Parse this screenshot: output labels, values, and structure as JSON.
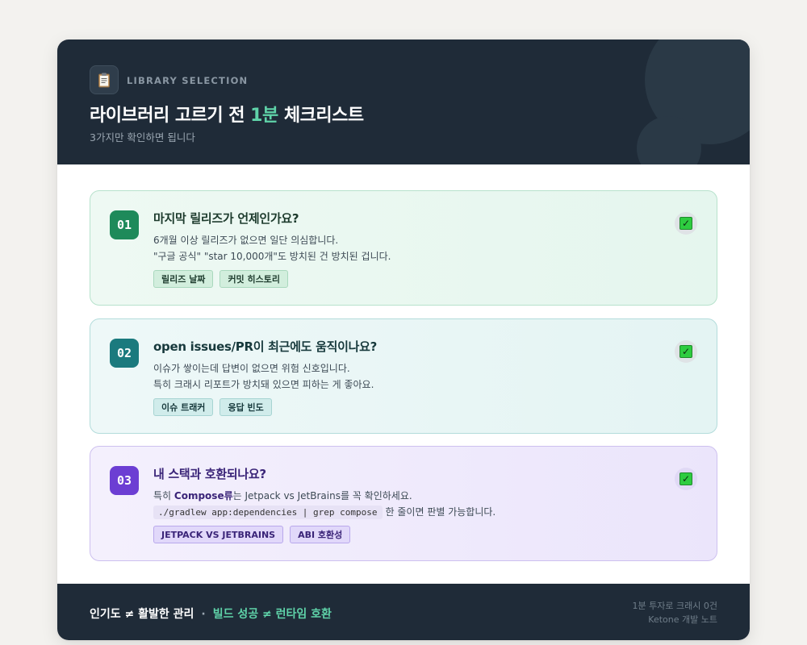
{
  "header": {
    "icon": "clipboard-icon",
    "eyebrow": "LIBRARY SELECTION",
    "title_prefix": "라이브러리 고르기 전 ",
    "title_accent": "1분",
    "title_suffix": " 체크리스트",
    "subtitle": "3가지만 확인하면 됩니다"
  },
  "items": [
    {
      "number": "01",
      "title": "마지막 릴리즈가 언제인가요?",
      "desc_line1": "6개월 이상 릴리즈가 없으면 일단 의심합니다.",
      "desc_line2": "\"구글 공식\" \"star 10,000개\"도 방치된 건 방치된 겁니다.",
      "tags": [
        "릴리즈 날짜",
        "커밋 히스토리"
      ],
      "checked": true
    },
    {
      "number": "02",
      "title": "open issues/PR이 최근에도 움직이나요?",
      "desc_line1": "이슈가 쌓이는데 답변이 없으면 위험 신호입니다.",
      "desc_line2": "특히 크래시 리포트가 방치돼 있으면 피하는 게 좋아요.",
      "tags": [
        "이슈 트래커",
        "응답 빈도"
      ],
      "checked": true
    },
    {
      "number": "03",
      "title": "내 스택과 호환되나요?",
      "desc_line1_pre": "특히 ",
      "desc_line1_bold": "Compose류",
      "desc_line1_post": "는 Jetpack vs JetBrains를 꼭 확인하세요.",
      "desc_line2_code": "./gradlew app:dependencies | grep compose",
      "desc_line2_post": "한 줄이면 판별 가능합니다.",
      "tags": [
        "JETPACK VS JETBRAINS",
        "ABI 호환성"
      ],
      "checked": true
    }
  ],
  "footer": {
    "left_1": "인기도 ≠ 활발한 관리",
    "separator": "·",
    "left_2": "빌드 성공 ≠ 런타임 호환",
    "right_1": "1분 투자로 크래시 0건",
    "right_2": "Ketone 개발 노트"
  },
  "colors": {
    "header_bg": "#1f2b38",
    "accent": "#5fd3a9",
    "item1_badge": "#1e8a5a",
    "item2_badge": "#1b7a7e",
    "item3_badge": "#6c3ed3",
    "check": "#2ecc40"
  }
}
